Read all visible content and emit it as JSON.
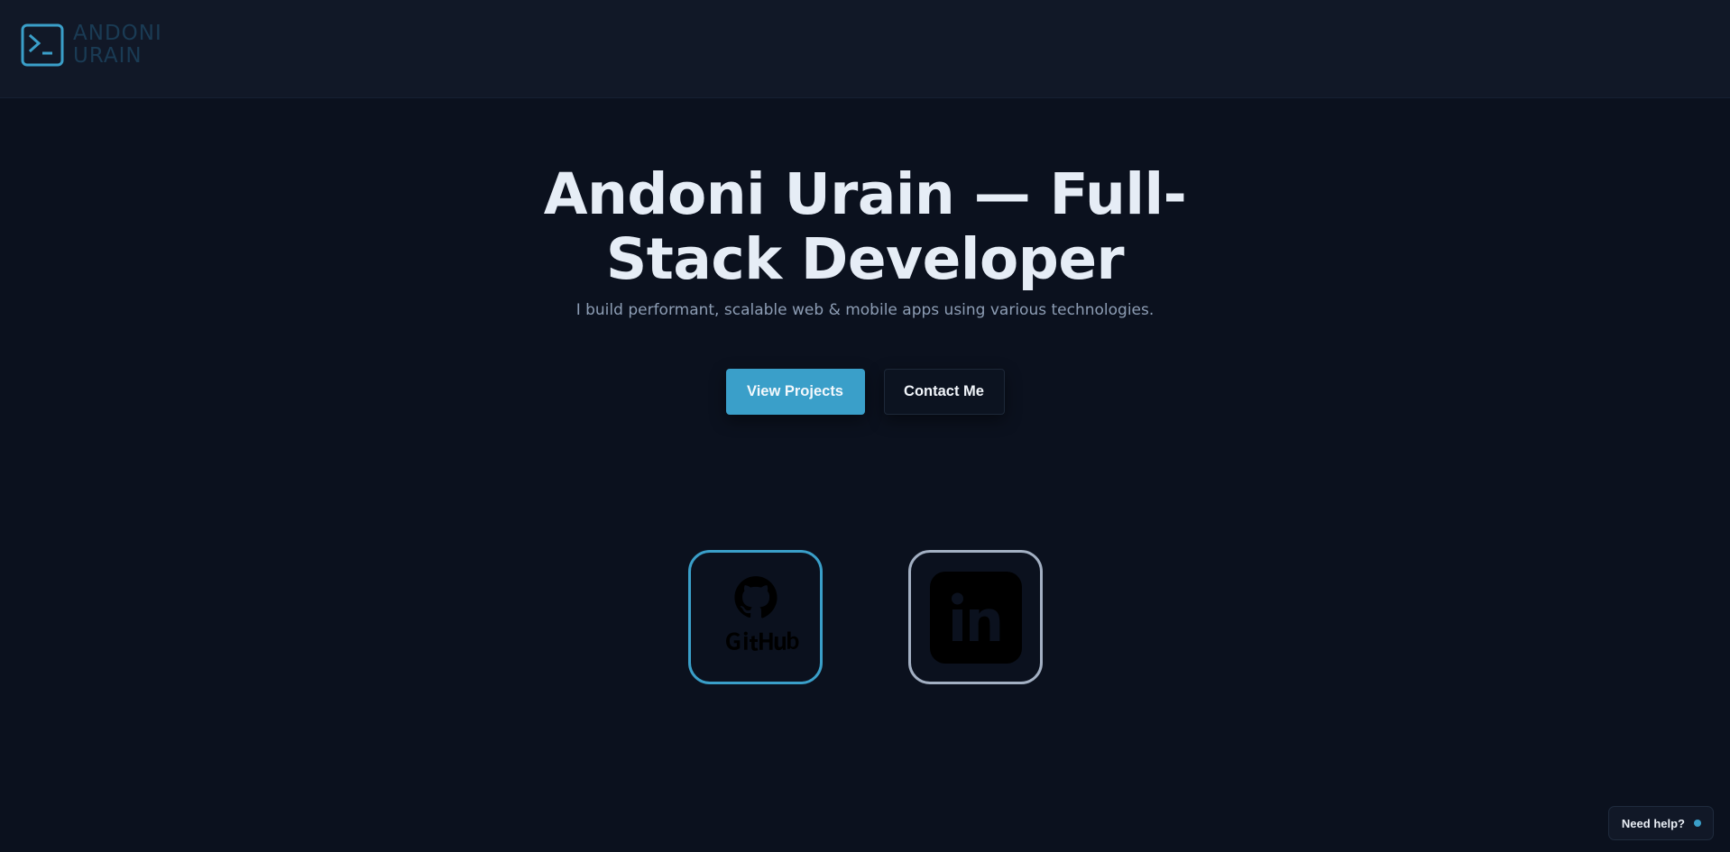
{
  "header": {
    "logo": {
      "icon": "terminal-prompt-icon",
      "line1": "ANDONI",
      "line2": "URAIN"
    }
  },
  "hero": {
    "title": "Andoni Urain — Full-Stack Developer",
    "subtitle": "I build performant, scalable web & mobile apps using various technologies.",
    "primary_button": "View Projects",
    "secondary_button": "Contact Me"
  },
  "social": [
    {
      "name": "GitHub",
      "icon": "github-icon"
    },
    {
      "name": "LinkedIn",
      "icon": "linkedin-icon"
    }
  ],
  "help_widget": {
    "label": "Need help?"
  },
  "colors": {
    "background": "#0b111e",
    "header": "#111827",
    "accent": "#3a9fc9",
    "title": "#e6edf6",
    "subtitle": "#8d9db4",
    "logo_text": "#1a3b54"
  }
}
